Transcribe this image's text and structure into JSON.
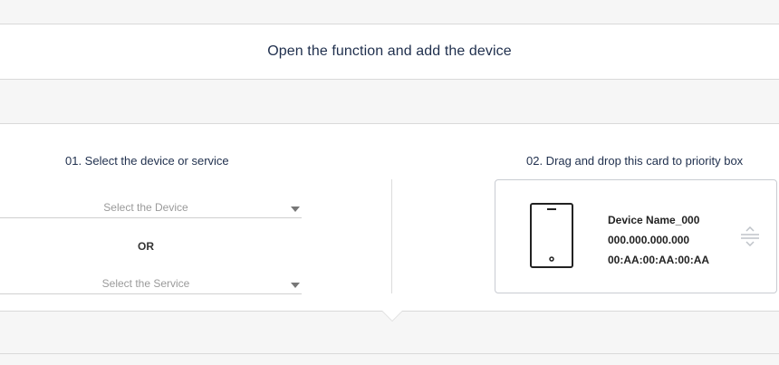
{
  "header": {
    "title": "Open the function and add the device"
  },
  "step1": {
    "title": "01. Select the device or service",
    "device_select": "Select the Device",
    "or_label": "OR",
    "service_select": "Select the Service"
  },
  "step2": {
    "title": "02. Drag and drop this card to priority box",
    "card": {
      "device_name": "Device Name_000",
      "ip": "000.000.000.000",
      "mac": "00:AA:00:AA:00:AA"
    }
  },
  "icons": [
    "phone-icon",
    "drag-handle-icon",
    "chevron-down-icon"
  ],
  "colors": {
    "text": "#1f2f4d",
    "border": "#d9d9d9",
    "background": "#f6f6f6"
  }
}
